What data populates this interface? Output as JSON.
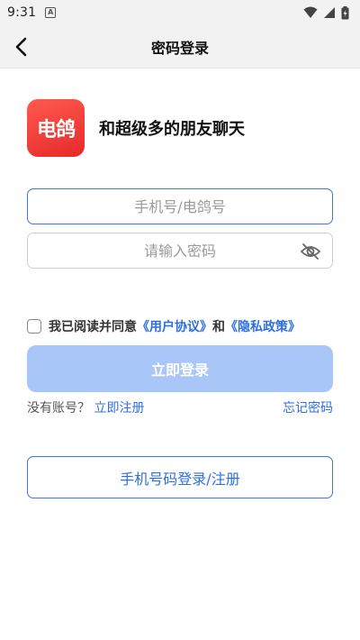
{
  "status_bar": {
    "time": "9:31",
    "notification_badge": "A"
  },
  "header": {
    "title": "密码登录"
  },
  "brand": {
    "logo_text": "电鸽",
    "slogan": "和超级多的朋友聊天"
  },
  "form": {
    "phone_placeholder": "手机号/电鸽号",
    "phone_value": "",
    "password_placeholder": "请输入密码",
    "password_value": ""
  },
  "agreement": {
    "checked": false,
    "prefix": "我已阅读并同意",
    "user_agreement": "《用户协议》",
    "conjunction": "和",
    "privacy_policy": "《隐私政策》"
  },
  "login_button": "立即登录",
  "register": {
    "prompt": "没有账号？",
    "link": "立即注册"
  },
  "forgot_password": "忘记密码",
  "phone_login_button": "手机号码登录/注册",
  "colors": {
    "accent": "#2d6fe0",
    "login_button_disabled": "#a8c6f7",
    "logo": "#e62a2a"
  }
}
